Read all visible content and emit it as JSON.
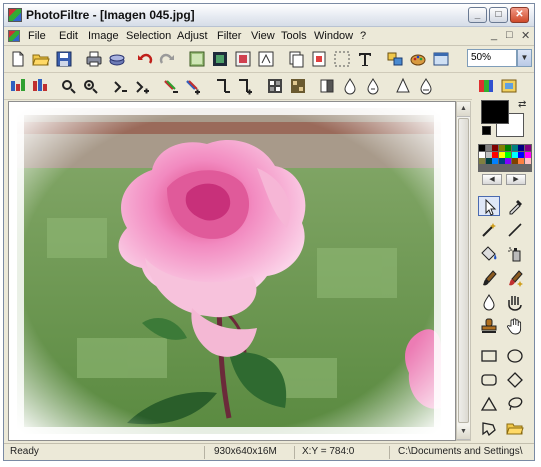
{
  "window": {
    "title": "PhotoFiltre - [Imagen 045.jpg]",
    "controls": {
      "minimize": "_",
      "maximize": "□",
      "close": "✕"
    }
  },
  "menubar": {
    "items": [
      "File",
      "Edit",
      "Image",
      "Selection",
      "Adjust",
      "Filter",
      "View",
      "Tools",
      "Window",
      "?"
    ],
    "doc_controls": [
      "_",
      "□",
      "✕"
    ]
  },
  "toolbar1": {
    "buttons": [
      "new-icon",
      "open-icon",
      "save-icon",
      "print-icon",
      "scanner-icon",
      "undo-icon",
      "redo-icon",
      "copy-icon",
      "paste-icon",
      "image-size-icon",
      "canvas-size-icon",
      "paste-as-icon",
      "crop-icon",
      "text-icon",
      "plugin-icon",
      "palette-icon",
      "fullscreen-icon"
    ],
    "zoom": {
      "value": "50%"
    }
  },
  "toolbar2": {
    "buttons": [
      "auto-levels-icon",
      "auto-contrast-icon",
      "brightness-minus-icon",
      "brightness-plus-icon",
      "contrast-minus-icon",
      "contrast-plus-icon",
      "saturation-minus-icon",
      "saturation-plus-icon",
      "gamma-minus-icon",
      "gamma-plus-icon",
      "grayscale-icon",
      "sepia-icon",
      "blur-icon",
      "sharpen-icon",
      "drop-blur-icon",
      "drop-sharpen-icon",
      "rgb-icon",
      "filter-icon"
    ]
  },
  "colors": {
    "foreground": "#000000",
    "background": "#ffffff",
    "palette": [
      "#000000",
      "#808080",
      "#800000",
      "#808000",
      "#008000",
      "#008080",
      "#000080",
      "#800080",
      "#ffffff",
      "#c0c0c0",
      "#ff0000",
      "#ffff00",
      "#00ff00",
      "#00ffff",
      "#0000ff",
      "#ff00ff",
      "#808040",
      "#004040",
      "#0080ff",
      "#004080",
      "#8000ff",
      "#804000",
      "#ff8040",
      "#ffc0c0"
    ]
  },
  "tools": [
    "selection-icon",
    "eyedropper-icon",
    "magic-wand-icon",
    "line-icon",
    "fill-bucket-icon",
    "spray-icon",
    "brush-icon",
    "effect-brush-icon",
    "blur-drop-icon",
    "smudge-icon",
    "stamp-icon",
    "hand-icon",
    "rectangle-icon",
    "ellipse-icon",
    "rounded-rect-icon",
    "diamond-icon",
    "triangle-icon",
    "lasso-icon",
    "polygon-icon",
    "open-folder-icon",
    "mode-icon",
    "bitmap-icon"
  ],
  "statusbar": {
    "state": "Ready",
    "image_info": "930x640x16M",
    "coords": "X:Y = 784:0",
    "path": "C:\\Documents and Settings\\"
  }
}
